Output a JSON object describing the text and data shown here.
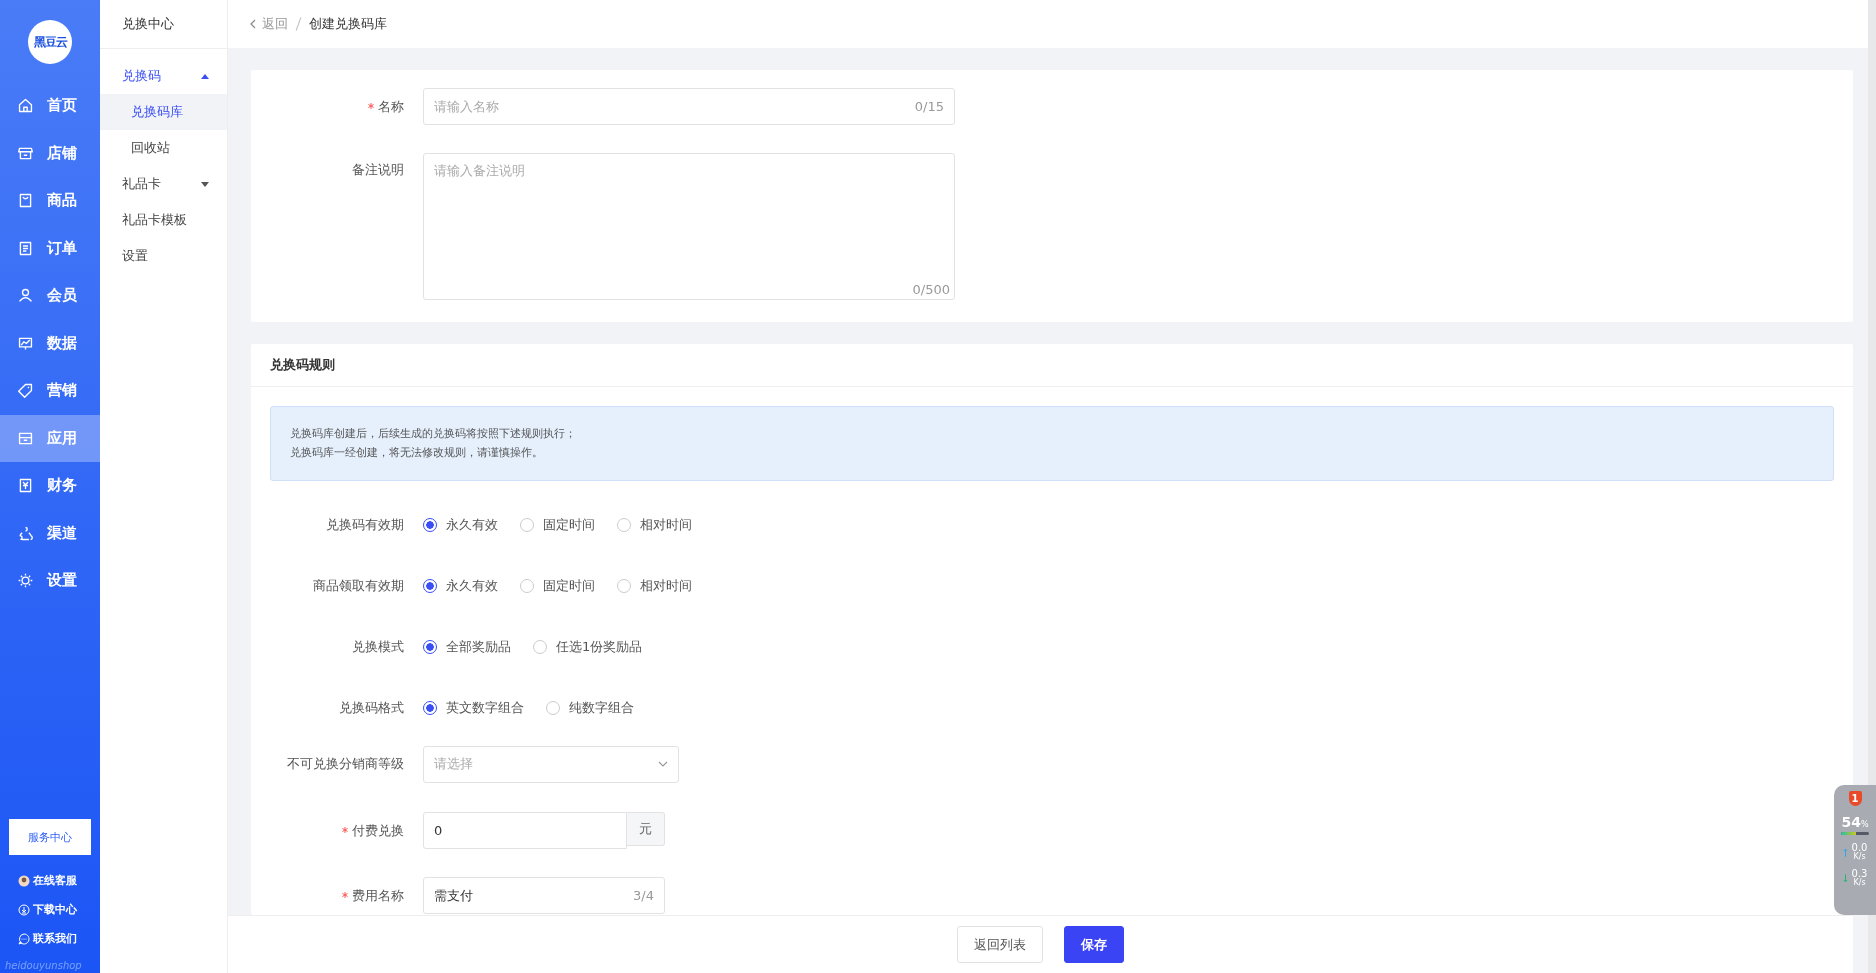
{
  "sidebar": {
    "logo": "黑豆云",
    "items": [
      {
        "label": "首页",
        "selected": false
      },
      {
        "label": "店铺",
        "selected": false
      },
      {
        "label": "商品",
        "selected": false
      },
      {
        "label": "订单",
        "selected": false
      },
      {
        "label": "会员",
        "selected": false
      },
      {
        "label": "数据",
        "selected": false
      },
      {
        "label": "营销",
        "selected": false
      },
      {
        "label": "应用",
        "selected": true
      },
      {
        "label": "财务",
        "selected": false
      },
      {
        "label": "渠道",
        "selected": false
      },
      {
        "label": "设置",
        "selected": false
      }
    ],
    "service_button": "服务中心",
    "links": [
      "在线客服",
      "下载中心",
      "联系我们"
    ],
    "footer": "heidouyunshop"
  },
  "subnav": {
    "title": "兑换中心",
    "items": [
      {
        "label": "兑换码",
        "expanded": true,
        "selected": true,
        "children": [
          {
            "label": "兑换码库",
            "selected": true
          },
          {
            "label": "回收站",
            "selected": false
          }
        ]
      },
      {
        "label": "礼品卡",
        "expanded": false,
        "selected": false
      },
      {
        "label": "礼品卡模板",
        "selected": false
      },
      {
        "label": "设置",
        "selected": false
      }
    ]
  },
  "breadcrumb": {
    "back": "返回",
    "current": "创建兑换码库"
  },
  "basic": {
    "name": {
      "label": "名称",
      "required": true,
      "placeholder": "请输入名称",
      "count": "0/15"
    },
    "remark": {
      "label": "备注说明",
      "required": false,
      "placeholder": "请输入备注说明",
      "count": "0/500"
    }
  },
  "rules": {
    "title": "兑换码规则",
    "notice": [
      "兑换码库创建后，后续生成的兑换码将按照下述规则执行；",
      "兑换码库一经创建，将无法修改规则，请谨慎操作。"
    ],
    "radio_groups": [
      {
        "label": "兑换码有效期",
        "options": [
          {
            "label": "永久有效",
            "selected": true
          },
          {
            "label": "固定时间",
            "selected": false
          },
          {
            "label": "相对时间",
            "selected": false
          }
        ]
      },
      {
        "label": "商品领取有效期",
        "options": [
          {
            "label": "永久有效",
            "selected": true
          },
          {
            "label": "固定时间",
            "selected": false
          },
          {
            "label": "相对时间",
            "selected": false
          }
        ]
      },
      {
        "label": "兑换模式",
        "options": [
          {
            "label": "全部奖励品",
            "selected": true
          },
          {
            "label": "任选1份奖励品",
            "selected": false
          }
        ]
      },
      {
        "label": "兑换码格式",
        "options": [
          {
            "label": "英文数字组合",
            "selected": true
          },
          {
            "label": "纯数字组合",
            "selected": false
          }
        ]
      }
    ],
    "distributor_level": {
      "label": "不可兑换分销商等级",
      "placeholder": "请选择"
    },
    "paid": {
      "label": "付费兑换",
      "required": true,
      "value": "0",
      "unit": "元"
    },
    "fee_name": {
      "label": "费用名称",
      "required": true,
      "value": "需支付",
      "count": "3/4"
    }
  },
  "footer_buttons": [
    {
      "label": "返回列表",
      "kind": "secondary"
    },
    {
      "label": "保存",
      "kind": "primary"
    }
  ],
  "monitor": {
    "badge": "1",
    "percent": "54",
    "unit": "%",
    "level": 0.54,
    "up": "0.0",
    "up_unit": "K/s",
    "down": "0.3",
    "down_unit": "K/s"
  }
}
